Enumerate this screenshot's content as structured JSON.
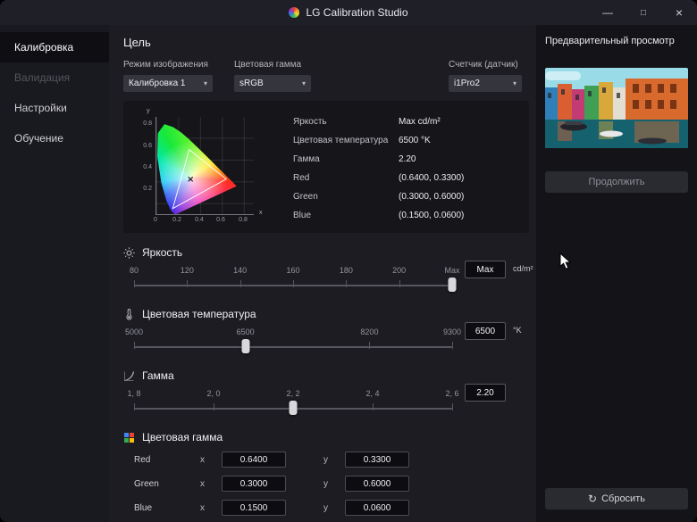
{
  "window": {
    "title": "LG Calibration Studio",
    "minimize_glyph": "—",
    "maximize_glyph": "□",
    "close_glyph": "×"
  },
  "sidebar": {
    "items": [
      {
        "label": "Калибровка"
      },
      {
        "label": "Валидация"
      },
      {
        "label": "Настройки"
      },
      {
        "label": "Обучение"
      }
    ]
  },
  "target": {
    "heading": "Цель",
    "picture_mode": {
      "label": "Режим изображения",
      "value": "Калибровка 1"
    },
    "color_gamut": {
      "label": "Цветовая гамма",
      "value": "sRGB"
    },
    "sensor": {
      "label": "Счетчик (датчик)",
      "value": "i1Pro2"
    },
    "dropdown_chevron": "▾",
    "chart": {
      "xlabel": "x",
      "ylabel": "y",
      "xticks": [
        "0",
        "0.2",
        "0.4",
        "0.6",
        "0.8"
      ],
      "yticks": [
        "0.2",
        "0.4",
        "0.6",
        "0.8"
      ],
      "white_point": "(0.3127, 0.3290)"
    },
    "summary": [
      {
        "label": "Яркость",
        "value": "Max cd/m²"
      },
      {
        "label": "Цветовая температура",
        "value": "6500 °K"
      },
      {
        "label": "Гамма",
        "value": "2.20"
      },
      {
        "label": "Red",
        "value": "(0.6400, 0.3300)"
      },
      {
        "label": "Green",
        "value": "(0.3000, 0.6000)"
      },
      {
        "label": "Blue",
        "value": "(0.1500, 0.0600)"
      }
    ]
  },
  "sliders": {
    "brightness": {
      "title": "Яркость",
      "ticks": [
        "80",
        "120",
        "140",
        "160",
        "180",
        "200",
        "Max"
      ],
      "value": "Max",
      "unit": "cd/m²"
    },
    "temperature": {
      "title": "Цветовая температура",
      "ticks": [
        "5000",
        "6500",
        "8200",
        "9300"
      ],
      "value": "6500",
      "unit": "°K"
    },
    "gamma": {
      "title": "Гамма",
      "ticks": [
        "1, 8",
        "2, 0",
        "2, 2",
        "2, 4",
        "2, 6"
      ],
      "value": "2.20",
      "unit": ""
    }
  },
  "gamut_section": {
    "title": "Цветовая гамма",
    "x_label": "x",
    "y_label": "y",
    "rows": [
      {
        "label": "Red",
        "x": "0.6400",
        "y": "0.3300"
      },
      {
        "label": "Green",
        "x": "0.3000",
        "y": "0.6000"
      },
      {
        "label": "Blue",
        "x": "0.1500",
        "y": "0.0600"
      }
    ]
  },
  "preview": {
    "title": "Предварительный просмотр",
    "continue_label": "Продолжить",
    "reset_label": "Сбросить",
    "reset_glyph": "↻"
  }
}
